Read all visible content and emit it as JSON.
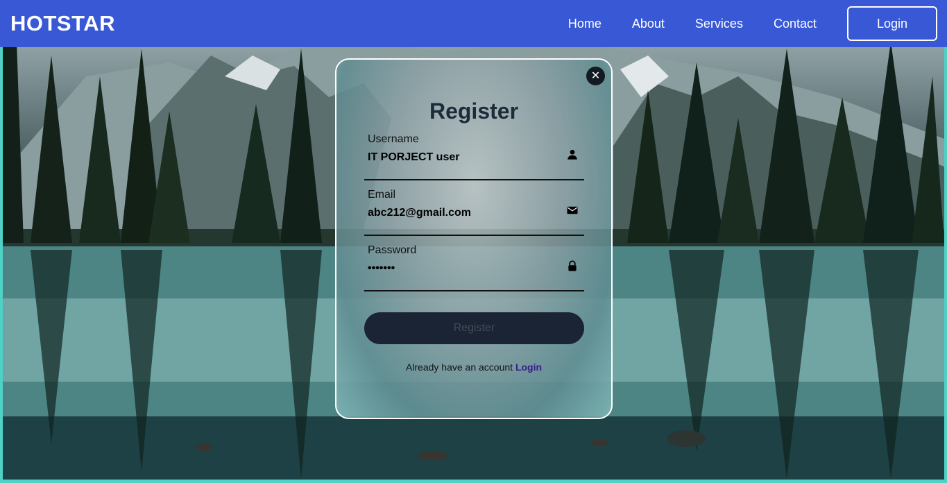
{
  "navbar": {
    "brand": "HOTSTAR",
    "links": [
      "Home",
      "About",
      "Services",
      "Contact"
    ],
    "login_label": "Login"
  },
  "modal": {
    "close_icon": "close-icon",
    "title": "Register",
    "fields": [
      {
        "label": "Username",
        "value": "IT PORJECT user",
        "icon": "person-icon",
        "type": "text"
      },
      {
        "label": "Email",
        "value": "abc212@gmail.com",
        "icon": "mail-icon",
        "type": "email"
      },
      {
        "label": "Password",
        "value": "1234567",
        "icon": "lock-icon",
        "type": "password"
      }
    ],
    "submit_label": "Register",
    "footer_text": "Already have an account",
    "footer_link": "Login"
  },
  "colors": {
    "navbar": "#3858d6",
    "button": "#1a2434",
    "title": "#1e2b3b",
    "link": "#3b1a8a"
  }
}
